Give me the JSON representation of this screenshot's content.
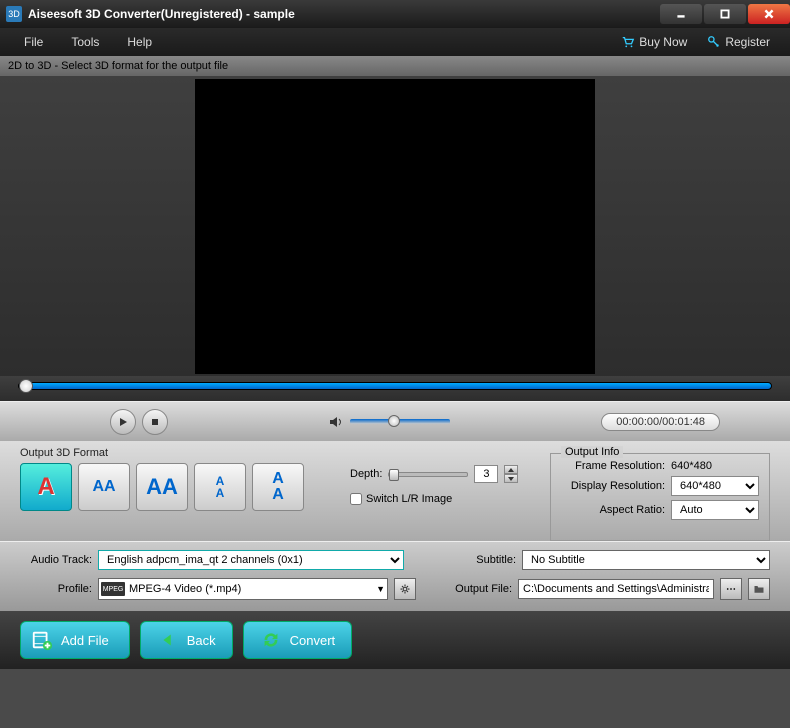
{
  "titlebar": {
    "title": "Aiseesoft 3D Converter(Unregistered) - sample"
  },
  "menu": {
    "file": "File",
    "tools": "Tools",
    "help": "Help",
    "buynow": "Buy Now",
    "register": "Register"
  },
  "infobar": "2D to 3D - Select 3D format for the output file",
  "time": "00:00:00/00:01:48",
  "output3d": {
    "label": "Output 3D Format",
    "depth_label": "Depth:",
    "depth_value": "3",
    "switch_label": "Switch L/R Image"
  },
  "outinfo": {
    "group": "Output Info",
    "frame_res_label": "Frame Resolution:",
    "frame_res_value": "640*480",
    "disp_res_label": "Display Resolution:",
    "disp_res_value": "640*480",
    "aspect_label": "Aspect Ratio:",
    "aspect_value": "Auto"
  },
  "settings": {
    "audio_label": "Audio Track:",
    "audio_value": "English adpcm_ima_qt 2 channels (0x1)",
    "subtitle_label": "Subtitle:",
    "subtitle_value": "No Subtitle",
    "profile_label": "Profile:",
    "profile_badge": "MPEG",
    "profile_value": "MPEG-4 Video (*.mp4)",
    "outfile_label": "Output File:",
    "outfile_value": "C:\\Documents and Settings\\Administrator\\My Doc"
  },
  "buttons": {
    "addfile": "Add File",
    "back": "Back",
    "convert": "Convert"
  },
  "format_glyphs": {
    "anaglyph": "A",
    "sbs_half": "AA",
    "sbs_full": "AA",
    "tb_half": "A",
    "tb_full": "A"
  }
}
